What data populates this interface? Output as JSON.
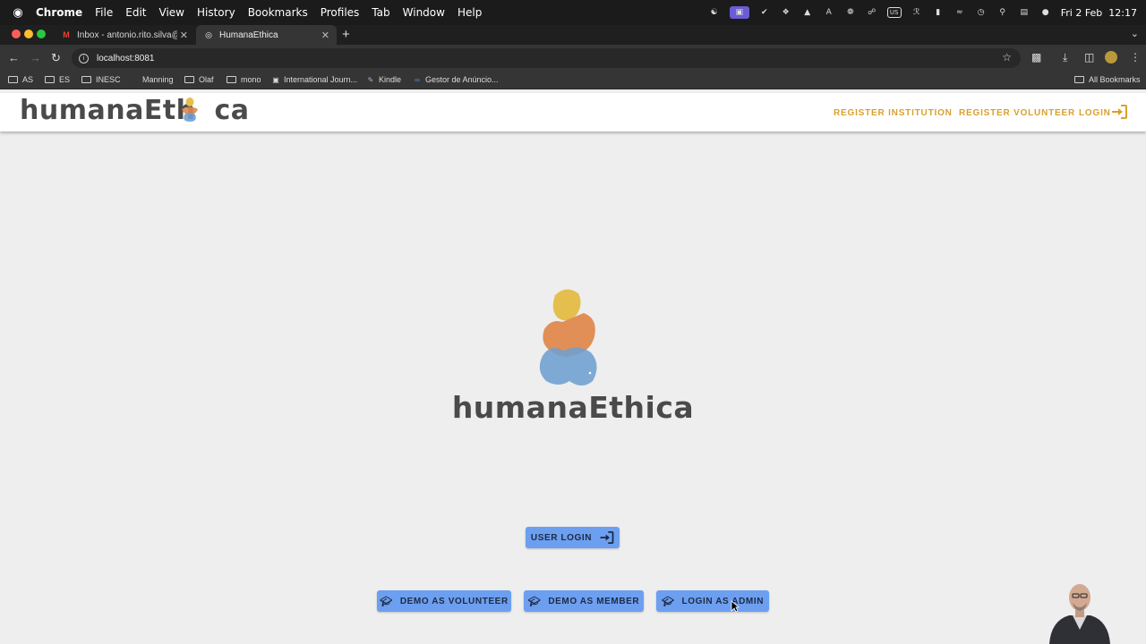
{
  "menubar": {
    "app": "Chrome",
    "items": [
      "File",
      "Edit",
      "View",
      "History",
      "Bookmarks",
      "Profiles",
      "Tab",
      "Window",
      "Help"
    ],
    "keyboard_layout": "US",
    "clock": "Fri 2 Feb  12:17"
  },
  "tabs": [
    {
      "title": "Inbox - antonio.rito.silva@gm",
      "icon": "gmail-icon"
    },
    {
      "title": "HumanaEthica",
      "icon": "globe-icon"
    }
  ],
  "toolbar": {
    "url": "localhost:8081"
  },
  "bookmarks": {
    "items": [
      {
        "label": "AS",
        "type": "folder"
      },
      {
        "label": "ES",
        "type": "folder"
      },
      {
        "label": "INESC",
        "type": "folder"
      },
      {
        "label": "Manning",
        "type": "link"
      },
      {
        "label": "Olaf",
        "type": "folder"
      },
      {
        "label": "mono",
        "type": "folder"
      },
      {
        "label": "International Journ...",
        "type": "link"
      },
      {
        "label": "Kindle",
        "type": "link"
      },
      {
        "label": "Gestor de Anúncio...",
        "type": "link"
      }
    ],
    "all_bookmarks": "All Bookmarks"
  },
  "header": {
    "logo_left": "humanaEth",
    "logo_right": "ca",
    "nav": {
      "register_institution": "REGISTER INSTITUTION",
      "register_volunteer": "REGISTER VOLUNTEER",
      "login": "LOGIN"
    }
  },
  "hero": {
    "title": "humanaEthica"
  },
  "buttons": {
    "user_login": "USER LOGIN",
    "demo_volunteer": "DEMO AS VOLUNTEER",
    "demo_member": "DEMO AS MEMBER",
    "login_admin": "LOGIN AS ADMIN"
  },
  "colors": {
    "accent": "#d9a030",
    "button": "#6c9ff0",
    "figure_yellow": "#e4bf4e",
    "figure_orange": "#e0874a",
    "figure_blue": "#6e9fd0"
  }
}
